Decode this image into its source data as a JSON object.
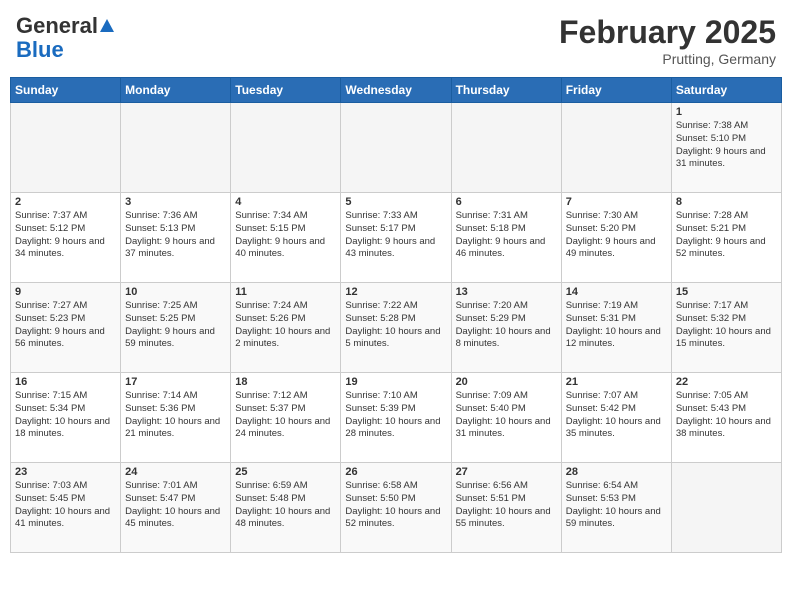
{
  "header": {
    "logo_general": "General",
    "logo_blue": "Blue",
    "month_title": "February 2025",
    "location": "Prutting, Germany"
  },
  "weekdays": [
    "Sunday",
    "Monday",
    "Tuesday",
    "Wednesday",
    "Thursday",
    "Friday",
    "Saturday"
  ],
  "weeks": [
    [
      {
        "day": "",
        "info": ""
      },
      {
        "day": "",
        "info": ""
      },
      {
        "day": "",
        "info": ""
      },
      {
        "day": "",
        "info": ""
      },
      {
        "day": "",
        "info": ""
      },
      {
        "day": "",
        "info": ""
      },
      {
        "day": "1",
        "info": "Sunrise: 7:38 AM\nSunset: 5:10 PM\nDaylight: 9 hours and 31 minutes."
      }
    ],
    [
      {
        "day": "2",
        "info": "Sunrise: 7:37 AM\nSunset: 5:12 PM\nDaylight: 9 hours and 34 minutes."
      },
      {
        "day": "3",
        "info": "Sunrise: 7:36 AM\nSunset: 5:13 PM\nDaylight: 9 hours and 37 minutes."
      },
      {
        "day": "4",
        "info": "Sunrise: 7:34 AM\nSunset: 5:15 PM\nDaylight: 9 hours and 40 minutes."
      },
      {
        "day": "5",
        "info": "Sunrise: 7:33 AM\nSunset: 5:17 PM\nDaylight: 9 hours and 43 minutes."
      },
      {
        "day": "6",
        "info": "Sunrise: 7:31 AM\nSunset: 5:18 PM\nDaylight: 9 hours and 46 minutes."
      },
      {
        "day": "7",
        "info": "Sunrise: 7:30 AM\nSunset: 5:20 PM\nDaylight: 9 hours and 49 minutes."
      },
      {
        "day": "8",
        "info": "Sunrise: 7:28 AM\nSunset: 5:21 PM\nDaylight: 9 hours and 52 minutes."
      }
    ],
    [
      {
        "day": "9",
        "info": "Sunrise: 7:27 AM\nSunset: 5:23 PM\nDaylight: 9 hours and 56 minutes."
      },
      {
        "day": "10",
        "info": "Sunrise: 7:25 AM\nSunset: 5:25 PM\nDaylight: 9 hours and 59 minutes."
      },
      {
        "day": "11",
        "info": "Sunrise: 7:24 AM\nSunset: 5:26 PM\nDaylight: 10 hours and 2 minutes."
      },
      {
        "day": "12",
        "info": "Sunrise: 7:22 AM\nSunset: 5:28 PM\nDaylight: 10 hours and 5 minutes."
      },
      {
        "day": "13",
        "info": "Sunrise: 7:20 AM\nSunset: 5:29 PM\nDaylight: 10 hours and 8 minutes."
      },
      {
        "day": "14",
        "info": "Sunrise: 7:19 AM\nSunset: 5:31 PM\nDaylight: 10 hours and 12 minutes."
      },
      {
        "day": "15",
        "info": "Sunrise: 7:17 AM\nSunset: 5:32 PM\nDaylight: 10 hours and 15 minutes."
      }
    ],
    [
      {
        "day": "16",
        "info": "Sunrise: 7:15 AM\nSunset: 5:34 PM\nDaylight: 10 hours and 18 minutes."
      },
      {
        "day": "17",
        "info": "Sunrise: 7:14 AM\nSunset: 5:36 PM\nDaylight: 10 hours and 21 minutes."
      },
      {
        "day": "18",
        "info": "Sunrise: 7:12 AM\nSunset: 5:37 PM\nDaylight: 10 hours and 24 minutes."
      },
      {
        "day": "19",
        "info": "Sunrise: 7:10 AM\nSunset: 5:39 PM\nDaylight: 10 hours and 28 minutes."
      },
      {
        "day": "20",
        "info": "Sunrise: 7:09 AM\nSunset: 5:40 PM\nDaylight: 10 hours and 31 minutes."
      },
      {
        "day": "21",
        "info": "Sunrise: 7:07 AM\nSunset: 5:42 PM\nDaylight: 10 hours and 35 minutes."
      },
      {
        "day": "22",
        "info": "Sunrise: 7:05 AM\nSunset: 5:43 PM\nDaylight: 10 hours and 38 minutes."
      }
    ],
    [
      {
        "day": "23",
        "info": "Sunrise: 7:03 AM\nSunset: 5:45 PM\nDaylight: 10 hours and 41 minutes."
      },
      {
        "day": "24",
        "info": "Sunrise: 7:01 AM\nSunset: 5:47 PM\nDaylight: 10 hours and 45 minutes."
      },
      {
        "day": "25",
        "info": "Sunrise: 6:59 AM\nSunset: 5:48 PM\nDaylight: 10 hours and 48 minutes."
      },
      {
        "day": "26",
        "info": "Sunrise: 6:58 AM\nSunset: 5:50 PM\nDaylight: 10 hours and 52 minutes."
      },
      {
        "day": "27",
        "info": "Sunrise: 6:56 AM\nSunset: 5:51 PM\nDaylight: 10 hours and 55 minutes."
      },
      {
        "day": "28",
        "info": "Sunrise: 6:54 AM\nSunset: 5:53 PM\nDaylight: 10 hours and 59 minutes."
      },
      {
        "day": "",
        "info": ""
      }
    ]
  ]
}
